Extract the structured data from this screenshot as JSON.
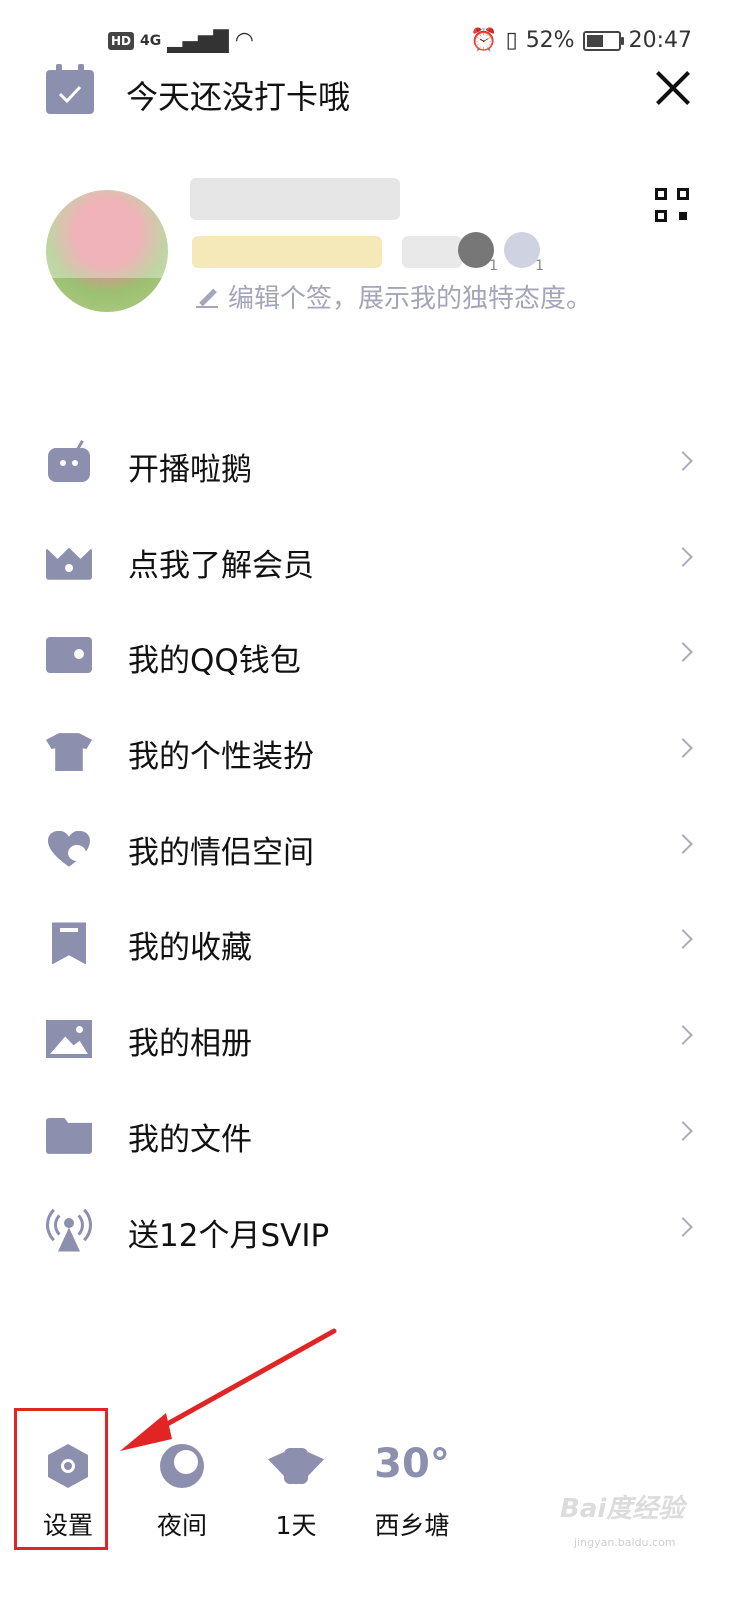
{
  "status_bar": {
    "hd": "HD",
    "network": "4G",
    "battery": "52%",
    "battery_fraction": 0.52,
    "time": "20:47"
  },
  "header": {
    "checkin_text": "今天还没打卡哦",
    "icons": [
      "calendar-check-icon",
      "close-icon"
    ]
  },
  "profile": {
    "signature_placeholder": "编辑个签，展示我的独特态度。",
    "level_badges": [
      "1",
      "1"
    ],
    "icons": [
      "avatar",
      "qr-code-icon",
      "pencil-icon"
    ]
  },
  "menu": {
    "items": [
      {
        "label": "开播啦鹅",
        "icon": "tv-robot-icon"
      },
      {
        "label": "点我了解会员",
        "icon": "crown-icon"
      },
      {
        "label": "我的QQ钱包",
        "icon": "wallet-icon"
      },
      {
        "label": "我的个性装扮",
        "icon": "tshirt-icon"
      },
      {
        "label": "我的情侣空间",
        "icon": "hearts-icon"
      },
      {
        "label": "我的收藏",
        "icon": "bookmark-icon"
      },
      {
        "label": "我的相册",
        "icon": "photo-icon"
      },
      {
        "label": "我的文件",
        "icon": "folder-icon"
      },
      {
        "label": "送12个月SVIP",
        "icon": "signal-tower-icon"
      }
    ]
  },
  "bottom_bar": {
    "settings_label": "设置",
    "night_label": "夜间",
    "days_label": "1天",
    "temperature": "30°",
    "location": "西乡塘"
  },
  "watermark": {
    "text": "Bai度经验",
    "sub": "jingyan.baidu.com"
  },
  "colors": {
    "icon": "#8d8fae",
    "highlight": "#e12424",
    "subtle_text": "#a3a6b8"
  }
}
